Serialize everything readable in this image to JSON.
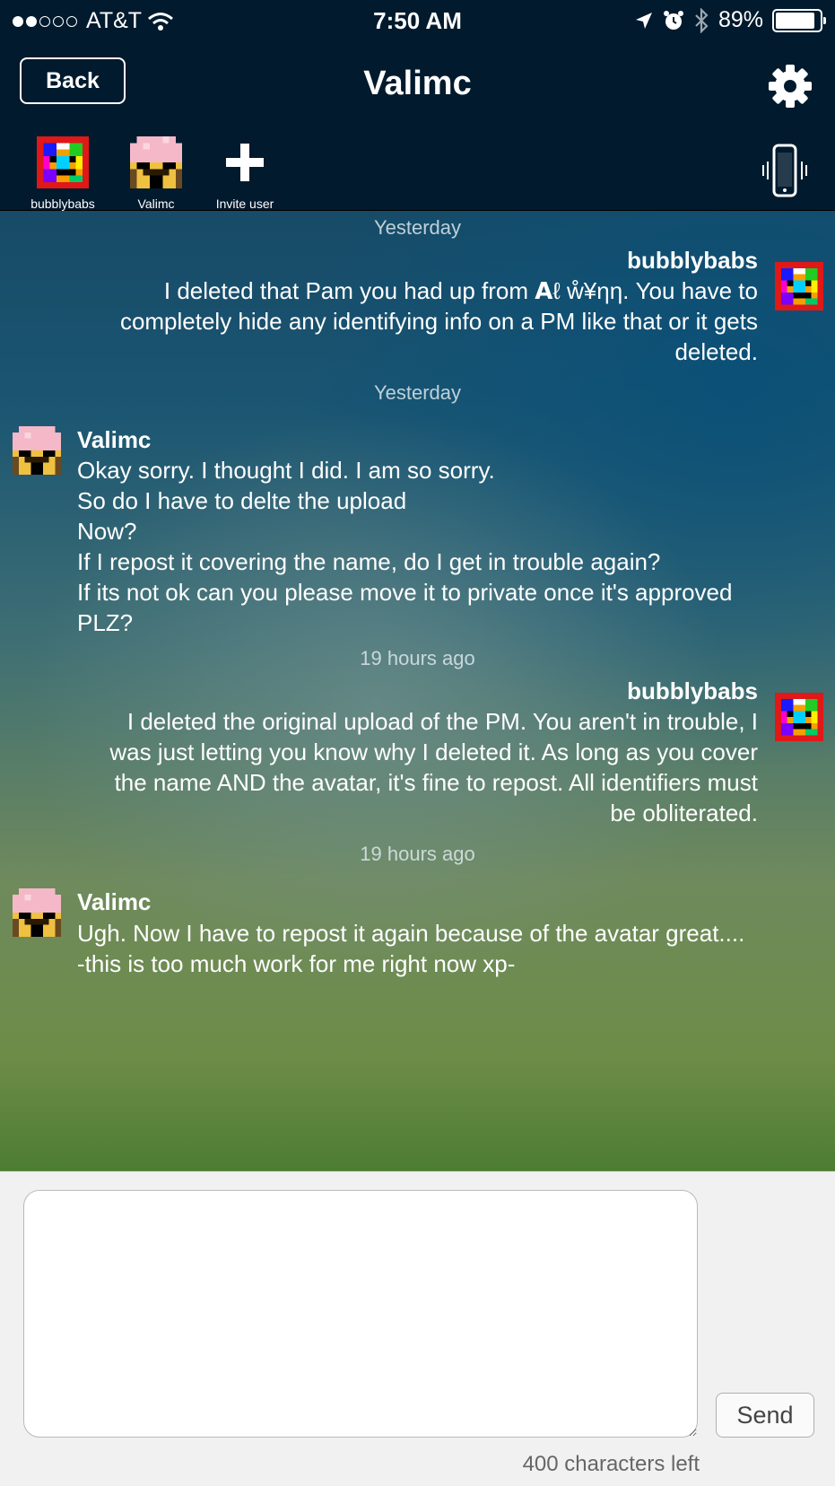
{
  "status_bar": {
    "carrier": "AT&T",
    "signal_bars_filled": 2,
    "signal_bars_total": 5,
    "time": "7:50 AM",
    "battery_percent": "89%",
    "battery_level": 0.89,
    "icons": [
      "wifi-icon",
      "location-arrow-icon",
      "alarm-icon",
      "bluetooth-icon",
      "battery-icon"
    ]
  },
  "nav": {
    "back_label": "Back",
    "title": "Valimc",
    "settings_icon": "gear-icon"
  },
  "participants": [
    {
      "name": "bubblybabs",
      "avatar": "rainbow-pixel-avatar"
    },
    {
      "name": "Valimc",
      "avatar": "pink-pixel-avatar"
    },
    {
      "name": "Invite user",
      "icon": "plus-icon"
    }
  ],
  "vibrate_icon": "phone-vibrate-icon",
  "messages": [
    {
      "timestamp": "Yesterday",
      "sender": "bubblybabs",
      "side": "right",
      "lines": [
        "I deleted that Pam you had up from 𝗔ℓ ẘ¥ηη.  You have to",
        "completely hide any identifying info on a PM like that or it gets",
        "deleted."
      ]
    },
    {
      "timestamp": "Yesterday",
      "sender": "Valimc",
      "side": "left",
      "lines": [
        "Okay sorry. I thought I did. I am so sorry.",
        "So do I have to delte the upload",
        "Now?",
        "If I repost it covering the name, do I get in trouble again?",
        "If its not ok can you please move it to private once it's approved",
        "PLZ?"
      ]
    },
    {
      "timestamp": "19 hours ago",
      "sender": "bubblybabs",
      "side": "right",
      "lines": [
        "I deleted the original upload of the PM.  You aren't in trouble, I",
        "was just letting you know why I deleted it.  As long as you cover",
        "the name AND the avatar, it's fine to repost.  All identifiers must",
        "be obliterated."
      ]
    },
    {
      "timestamp": "19 hours ago",
      "sender": "Valimc",
      "side": "left",
      "lines": [
        "Ugh. Now I have to repost it again because of the avatar great....",
        "-this is too much work for me right now xp-"
      ]
    }
  ],
  "composer": {
    "input_value": "",
    "send_label": "Send",
    "chars_left": "400 characters left"
  },
  "colors": {
    "header_bg": "#011a2d",
    "composer_bg": "#f1f1f1"
  }
}
